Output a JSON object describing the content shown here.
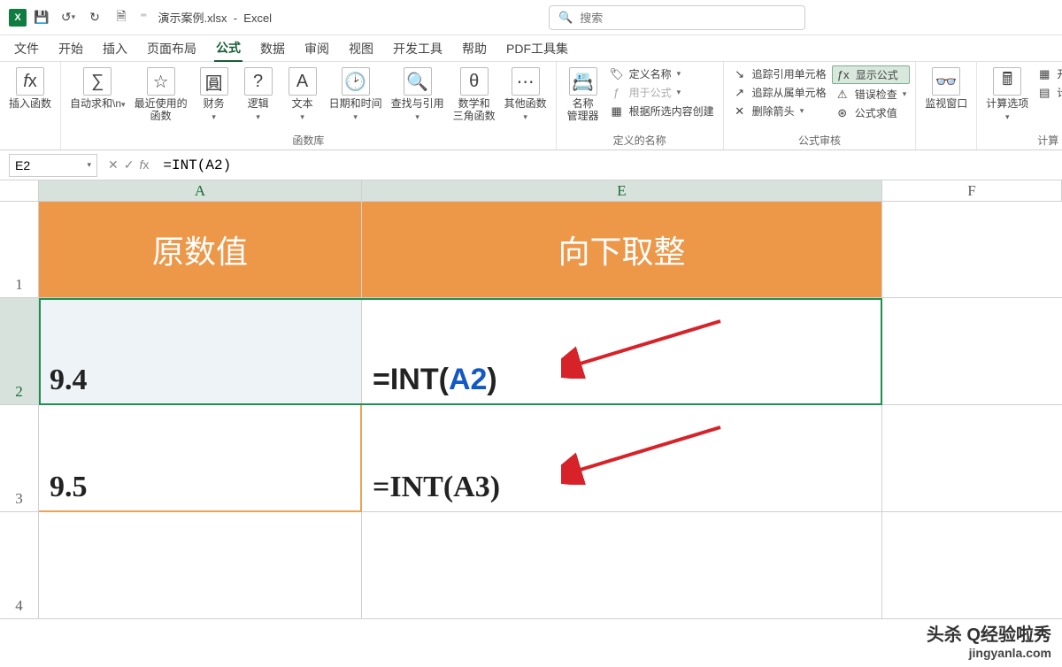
{
  "title": {
    "doc": "演示案例.xlsx",
    "app": "Excel",
    "sep": "-"
  },
  "search": {
    "placeholder": "搜索"
  },
  "tabs": {
    "file": "文件",
    "home": "开始",
    "insert": "插入",
    "layout": "页面布局",
    "formulas": "公式",
    "data": "数据",
    "review": "审阅",
    "view": "视图",
    "dev": "开发工具",
    "help": "帮助",
    "pdf": "PDF工具集"
  },
  "ribbon": {
    "insertfn": "插入函数",
    "autosum": "自动求和",
    "recent": "最近使用的\n函数",
    "financial": "财务",
    "logical": "逻辑",
    "text": "文本",
    "datetime": "日期和时间",
    "lookup": "查找与引用",
    "math": "数学和\n三角函数",
    "more": "其他函数",
    "grp_lib": "函数库",
    "namemgr": "名称\n管理器",
    "defname": "定义名称",
    "usefml": "用于公式",
    "create": "根据所选内容创建",
    "grp_names": "定义的名称",
    "traceprec": "追踪引用单元格",
    "tracedep": "追踪从属单元格",
    "remarrow": "删除箭头",
    "showf": "显示公式",
    "errchk": "错误检查",
    "eval": "公式求值",
    "grp_audit": "公式审核",
    "watch": "监视窗口",
    "calcopt": "计算选项",
    "calcnow": "开始计算",
    "calcsheet": "计算工作表",
    "grp_calc": "计算"
  },
  "fbar": {
    "name": "E2",
    "formula": "=INT(A2)"
  },
  "cols": {
    "A": "A",
    "E": "E",
    "F": "F"
  },
  "rows": {
    "r1": "1",
    "r2": "2",
    "r3": "3",
    "r4": "4"
  },
  "cells": {
    "A1": "原数值",
    "E1": "向下取整",
    "A2": "9.4",
    "E2_pre": "=INT(",
    "E2_ref": "A2",
    "E2_post": ")",
    "A3": "9.5",
    "E3": "=INT(A3)"
  },
  "watermark": {
    "l1": "头杀 Q经验啦秀",
    "l2": "jingyanla.com"
  },
  "chart_data": {
    "type": "table",
    "title": "向下取整",
    "columns": [
      "原数值",
      "向下取整"
    ],
    "rows": [
      {
        "原数值": 9.4,
        "向下取整": "=INT(A2)"
      },
      {
        "原数值": 9.5,
        "向下取整": "=INT(A3)"
      }
    ]
  }
}
